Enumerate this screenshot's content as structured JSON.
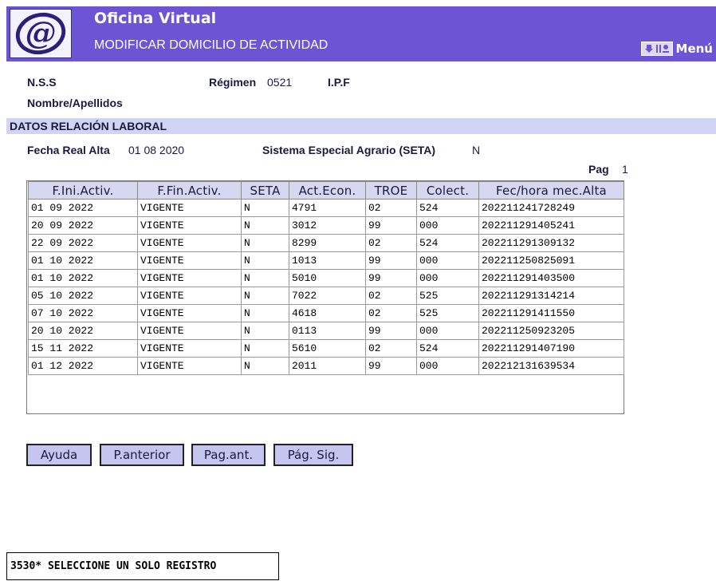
{
  "header": {
    "title": "Oficina Virtual",
    "subtitle": "MODIFICAR DOMICILIO DE ACTIVIDAD",
    "menu_label": "Menú",
    "colors": {
      "header_bg": "#6b55d4",
      "section_bg": "#d3d3f2",
      "button_bg": "#c5c5ef"
    }
  },
  "person": {
    "nss_label": "N.S.S",
    "nss_value": "",
    "regimen_label": "Régimen",
    "regimen_value": "0521",
    "ipf_label": "I.P.F",
    "ipf_value": "",
    "nombre_label": "Nombre/Apellidos",
    "nombre_value": ""
  },
  "section": {
    "title": "DATOS RELACIÓN LABORAL",
    "fecha_label": "Fecha Real Alta",
    "fecha_value": "01 08 2020",
    "seta_label": "Sistema Especial Agrario (SETA)",
    "seta_value": "N",
    "pag_label": "Pag",
    "pag_value": "1"
  },
  "table": {
    "columns": [
      "F.Ini.Activ.",
      "F.Fin.Activ.",
      "SETA",
      "Act.Econ.",
      "TROE",
      "Colect.",
      "Fec/hora mec.Alta"
    ],
    "rows": [
      [
        "01 09 2022",
        "VIGENTE",
        "N",
        "4791",
        "02",
        "524",
        "202211241728249"
      ],
      [
        "20 09 2022",
        "VIGENTE",
        "N",
        "3012",
        "99",
        "000",
        "202211291405241"
      ],
      [
        "22 09 2022",
        "VIGENTE",
        "N",
        "8299",
        "02",
        "524",
        "202211291309132"
      ],
      [
        "01 10 2022",
        "VIGENTE",
        "N",
        "1013",
        "99",
        "000",
        "202211250825091"
      ],
      [
        "01 10 2022",
        "VIGENTE",
        "N",
        "5010",
        "99",
        "000",
        "202211291403500"
      ],
      [
        "05 10 2022",
        "VIGENTE",
        "N",
        "7022",
        "02",
        "525",
        "202211291314214"
      ],
      [
        "07 10 2022",
        "VIGENTE",
        "N",
        "4618",
        "02",
        "525",
        "202211291411550"
      ],
      [
        "20 10 2022",
        "VIGENTE",
        "N",
        "0113",
        "99",
        "000",
        "202211250923205"
      ],
      [
        "15 11 2022",
        "VIGENTE",
        "N",
        "5610",
        "02",
        "524",
        "202211291407190"
      ],
      [
        "01 12 2022",
        "VIGENTE",
        "N",
        "2011",
        "99",
        "000",
        "202212131639534"
      ]
    ]
  },
  "buttons": {
    "ayuda": "Ayuda",
    "p_anterior": "P.anterior",
    "pag_ant": "Pag.ant.",
    "pag_sig": "Pág. Sig."
  },
  "status": {
    "message": "3530* SELECCIONE UN SOLO REGISTRO"
  }
}
